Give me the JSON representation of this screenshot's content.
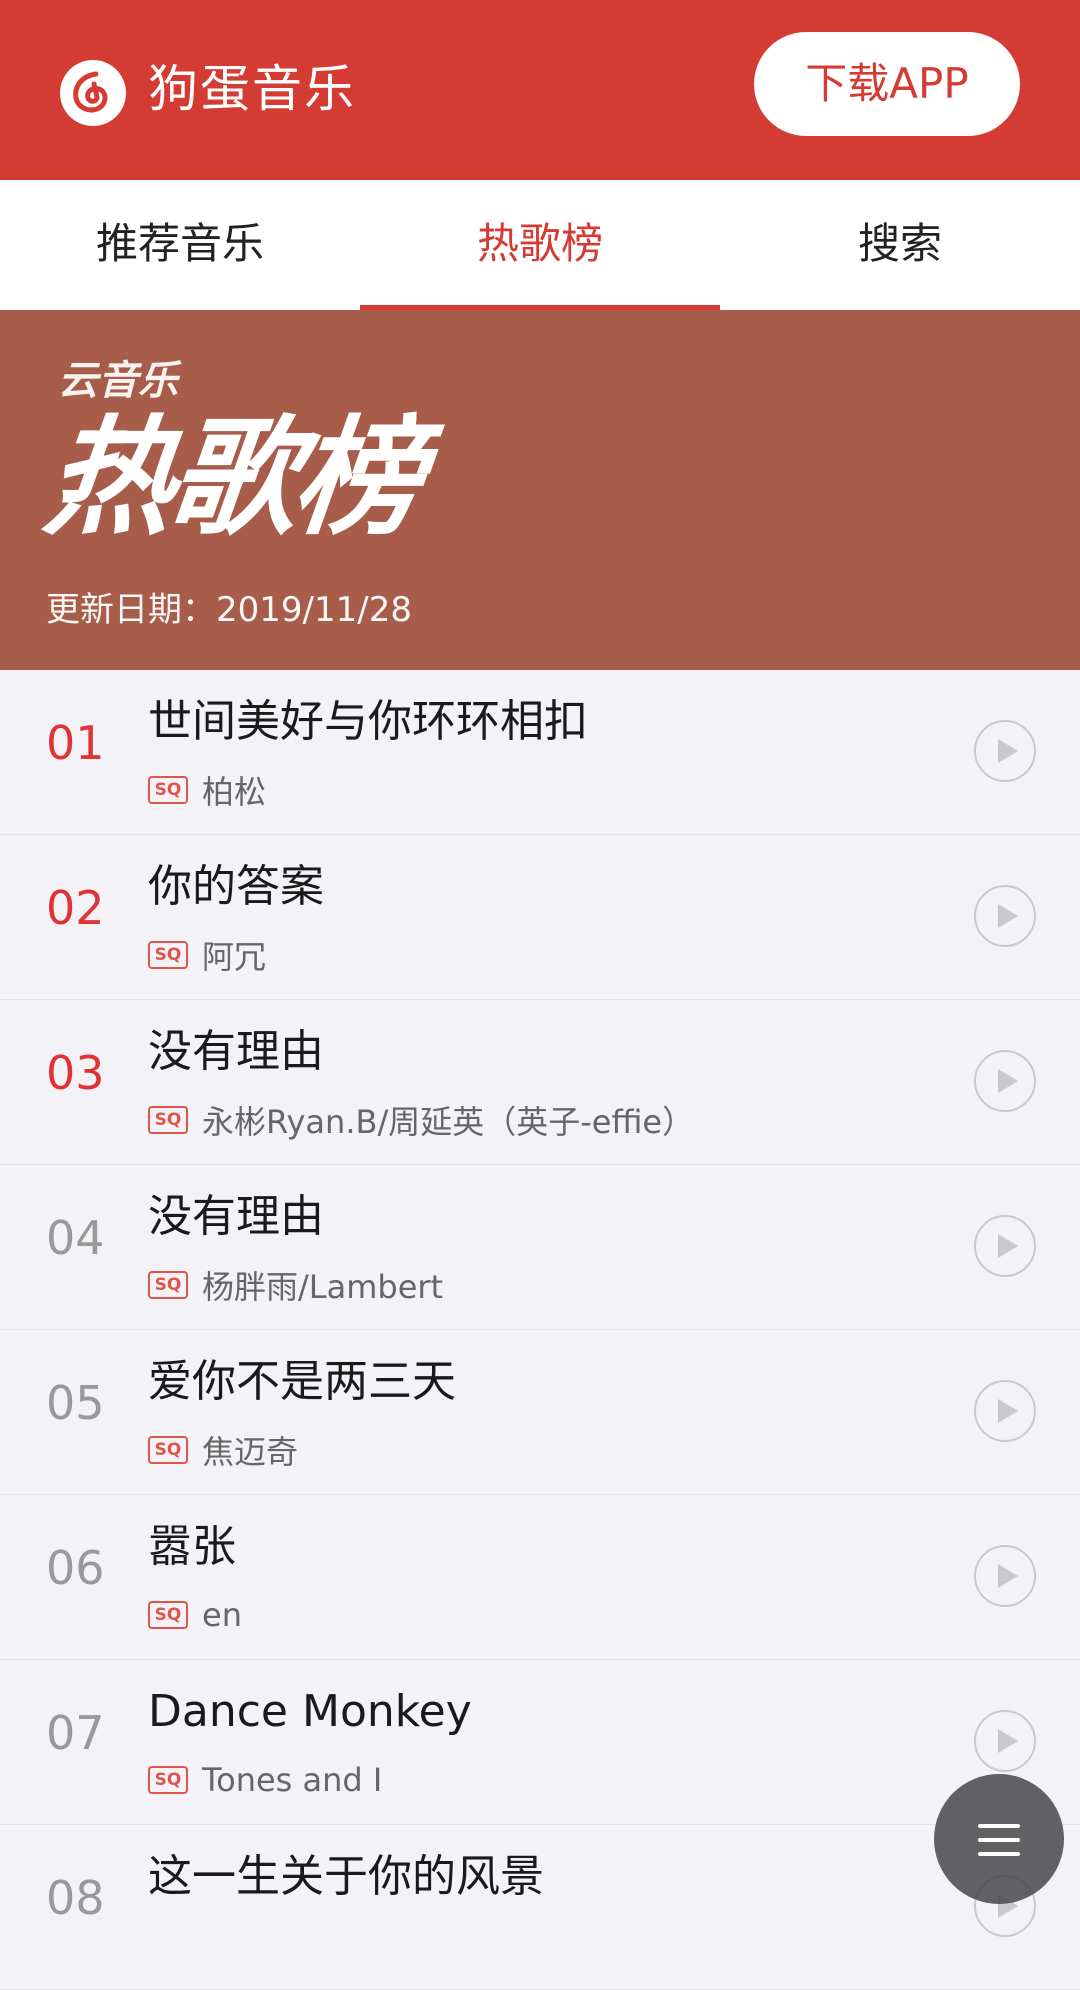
{
  "header": {
    "app_title": "狗蛋音乐",
    "download_label": "下载APP",
    "logo_icon": "netease-music-logo-icon",
    "brand_color": "#d43c33"
  },
  "tabs": [
    {
      "label": "推荐音乐",
      "active": false
    },
    {
      "label": "热歌榜",
      "active": true
    },
    {
      "label": "搜索",
      "active": false
    }
  ],
  "banner": {
    "subtitle": "云音乐",
    "title": "热歌榜",
    "date_label": "更新日期：2019/11/28",
    "background_color": "#a75d4a"
  },
  "quality_badge": "SQ",
  "songs": [
    {
      "rank": "01",
      "title": "世间美好与你环环相扣",
      "artist": "柏松"
    },
    {
      "rank": "02",
      "title": "你的答案",
      "artist": "阿冗"
    },
    {
      "rank": "03",
      "title": "没有理由",
      "artist": "永彬Ryan.B/周延英（英子-effie）"
    },
    {
      "rank": "04",
      "title": "没有理由",
      "artist": "杨胖雨/Lambert"
    },
    {
      "rank": "05",
      "title": "爱你不是两三天",
      "artist": "焦迈奇"
    },
    {
      "rank": "06",
      "title": "嚣张",
      "artist": "en"
    },
    {
      "rank": "07",
      "title": "Dance Monkey",
      "artist": "Tones and I"
    },
    {
      "rank": "08",
      "title": "这一生关于你的风景",
      "artist": ""
    }
  ],
  "icons": {
    "play": "play-circle-icon",
    "menu": "hamburger-menu-icon"
  }
}
